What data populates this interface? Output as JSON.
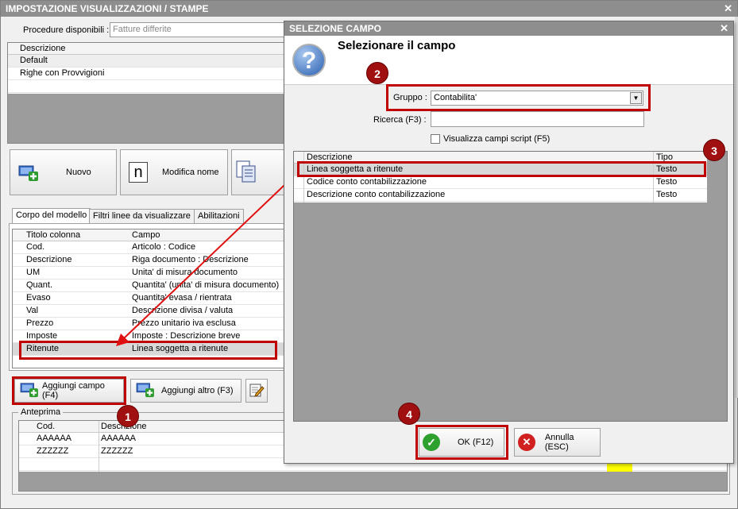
{
  "main": {
    "title": "IMPOSTAZIONE VISUALIZZAZIONI / STAMPE",
    "procedure_label": "Procedure disponibili :",
    "procedure_value": "Fatture differite",
    "models_header": "Descrizione",
    "models": [
      "Default",
      "Righe con Provvigioni"
    ],
    "btn_nuovo": "Nuovo",
    "btn_modifica": "Modifica nome",
    "tabs": [
      "Corpo del modello",
      "Filtri linee da visualizzare",
      "Abilitazioni"
    ],
    "columns_headers": [
      "Titolo colonna",
      "Campo"
    ],
    "columns": [
      [
        "Cod.",
        "Articolo : Codice"
      ],
      [
        "Descrizione",
        "Riga documento : Descrizione"
      ],
      [
        "UM",
        "Unita' di misura documento"
      ],
      [
        "Quant.",
        "Quantita' (unita' di misura documento)"
      ],
      [
        "Evaso",
        "Quantita' evasa / rientrata"
      ],
      [
        "Val",
        "Descrizione divisa / valuta"
      ],
      [
        "Prezzo",
        "Prezzo unitario iva esclusa"
      ],
      [
        "Imposte",
        "Imposte : Descrizione breve"
      ],
      [
        "Ritenute",
        "Linea soggetta a ritenute"
      ]
    ],
    "btn_aggiungi_campo": "Aggiungi campo (F4)",
    "btn_aggiungi_altro": "Aggiungi altro (F3)",
    "preview_label": "Anteprima",
    "preview_headers": [
      "Cod.",
      "Descrizione"
    ],
    "preview_rows": [
      [
        "AAAAAA",
        "AAAAAA"
      ],
      [
        "ZZZZZZ",
        "ZZZZZZ"
      ]
    ]
  },
  "dialog": {
    "title": "SELEZIONE CAMPO",
    "heading": "Selezionare il campo",
    "gruppo_label": "Gruppo :",
    "gruppo_value": "Contabilita'",
    "ricerca_label": "Ricerca (F3) :",
    "ricerca_value": "",
    "checkbox_label": "Visualizza campi script (F5)",
    "list_headers": [
      "Descrizione",
      "Tipo"
    ],
    "list_rows": [
      [
        "Linea soggetta a ritenute",
        "Testo"
      ],
      [
        "Codice conto contabilizzazione",
        "Testo"
      ],
      [
        "Descrizione conto contabilizzazione",
        "Testo"
      ]
    ],
    "btn_ok": "OK (F12)",
    "btn_annulla": "Annulla (ESC)"
  },
  "callouts": [
    "1",
    "2",
    "3",
    "4"
  ],
  "colors": {
    "callout": "#c00000",
    "titlebar": "#8e8e8e",
    "grid_dark": "#9c9c9c",
    "highlight_row": "#d9d9d9"
  }
}
